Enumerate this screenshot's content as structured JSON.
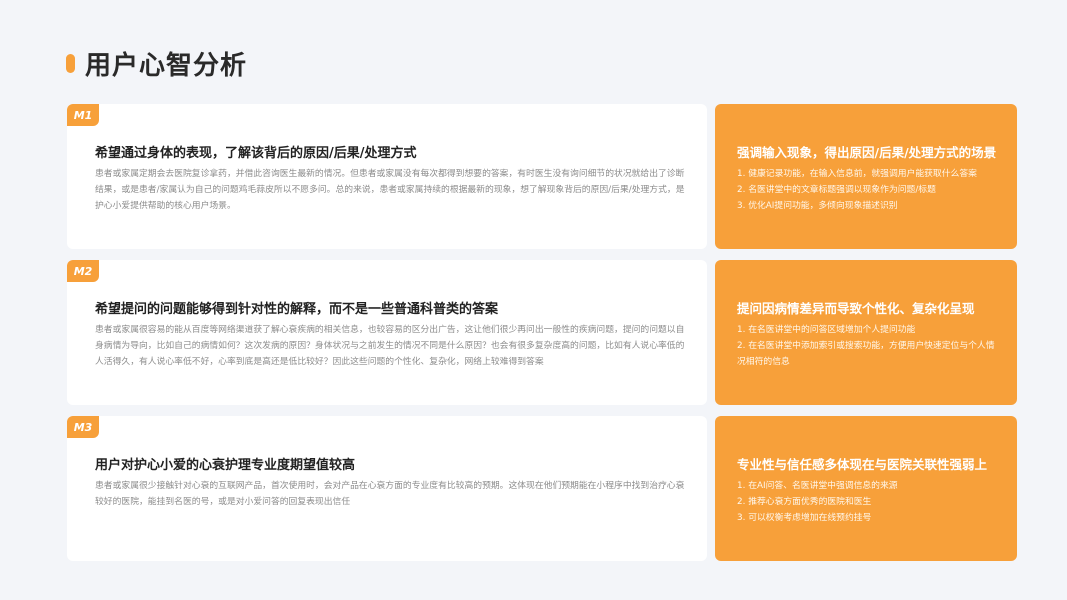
{
  "page_title": "用户心智分析",
  "colors": {
    "accent": "#f7a03a",
    "background": "#f3f5f9"
  },
  "rows": [
    {
      "badge": "M1",
      "heading": "希望通过身体的表现，了解该背后的原因/后果/处理方式",
      "body": "患者或家属定期会去医院复诊拿药，并借此咨询医生最新的情况。但患者或家属没有每次都得到想要的答案，有时医生没有询问细节的状况就给出了诊断结果，或是患者/家属认为自己的问题鸡毛蒜皮所以不愿多问。总的来说，患者或家属持续的根据最新的现象，想了解现象背后的原因/后果/处理方式，是护心小爱提供帮助的核心用户场景。",
      "right_heading": "强调输入现象，得出原因/后果/处理方式的场景",
      "right_items": [
        "1. 健康记录功能，在输入信息前，就强调用户能获取什么答案",
        "2. 名医讲堂中的文章标题强调以现象作为问题/标题",
        "3. 优化AI提问功能，多倾向现象描述识别"
      ]
    },
    {
      "badge": "M2",
      "heading": "希望提问的问题能够得到针对性的解释，而不是一些普通科普类的答案",
      "body": "患者或家属很容易的能从百度等网络渠道获了解心衰疾病的相关信息，也较容易的区分出广告，这让他们很少再问出一般性的疾病问题，提问的问题以自身病情为导向，比如自己的病情如何？这次发病的原因？身体状况与之前发生的情况不同是什么原因？也会有很多复杂度高的问题，比如有人说心率低的人活得久，有人说心率低不好，心率到底是高还是低比较好？因此这些问题的个性化、复杂化，网络上较难得到答案",
      "right_heading": "提问因病情差异而导致个性化、复杂化呈现",
      "right_items": [
        "1. 在名医讲堂中的问答区域增加个人提问功能",
        "2. 在名医讲堂中添加索引或搜索功能，方便用户快速定位与个人情况相符的信息"
      ]
    },
    {
      "badge": "M3",
      "heading": "用户对护心小爱的心衰护理专业度期望值较高",
      "body": "患者或家属很少接触针对心衰的互联网产品，首次使用时，会对产品在心衰方面的专业度有比较高的预期。这体现在他们预期能在小程序中找到治疗心衰较好的医院，能挂到名医的号，或是对小爱问答的回复表现出信任",
      "right_heading": "专业性与信任感多体现在与医院关联性强弱上",
      "right_items": [
        "1. 在AI问答、名医讲堂中强调信息的来源",
        "2. 推荐心衰方面优秀的医院和医生",
        "3. 可以权衡考虑增加在线预约挂号"
      ]
    }
  ]
}
